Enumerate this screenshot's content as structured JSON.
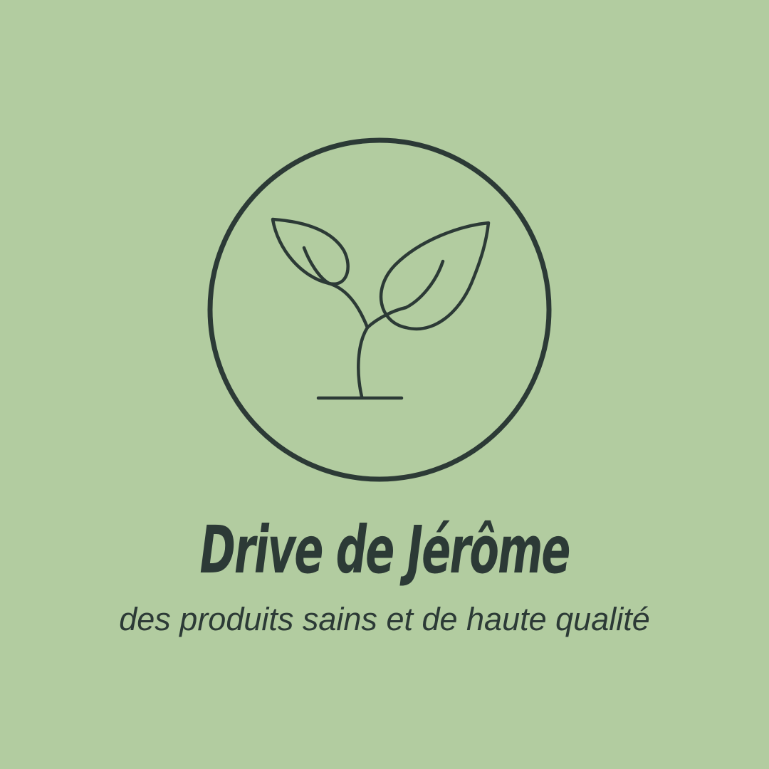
{
  "colors": {
    "background": "#b2cca0",
    "ink": "#2c3a36"
  },
  "logo": {
    "icon": "seedling-icon",
    "frame": "circle-outline"
  },
  "brand_name": "Drive de Jérôme",
  "tagline": "des produits sains et de haute qualité"
}
